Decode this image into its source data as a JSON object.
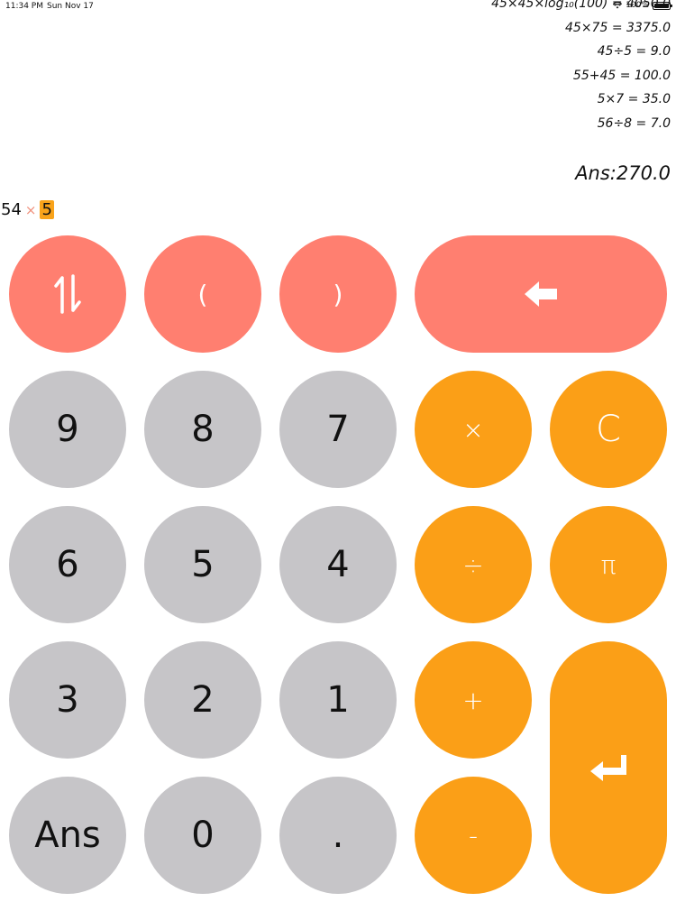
{
  "status": {
    "time": "11:34 PM",
    "date": "Sun Nov 17",
    "battery": "100%"
  },
  "history": [
    "45×45×log₁₀(100) = 4050.0",
    "45×75 = 3375.0",
    "45÷5 = 9.0",
    "55+45 = 100.0",
    "5×7 = 35.0",
    "56÷8 = 7.0"
  ],
  "answer": "Ans:270.0",
  "expression": {
    "left": "54",
    "operator": "×",
    "current": "5"
  },
  "keys": {
    "swap": "⥮",
    "open_paren": "(",
    "close_paren": ")",
    "backspace": "⬅",
    "nine": "9",
    "eight": "8",
    "seven": "7",
    "multiply": "×",
    "clear": "C",
    "six": "6",
    "five": "5",
    "four": "4",
    "divide": "÷",
    "pi": "π",
    "three": "3",
    "two": "2",
    "one": "1",
    "add": "+",
    "enter": "↵",
    "ans": "Ans",
    "zero": "0",
    "dot": ".",
    "subtract": "-"
  },
  "colors": {
    "gray": "#c6c5c8",
    "orange": "#fb9f17",
    "red": "#ff7f70"
  }
}
